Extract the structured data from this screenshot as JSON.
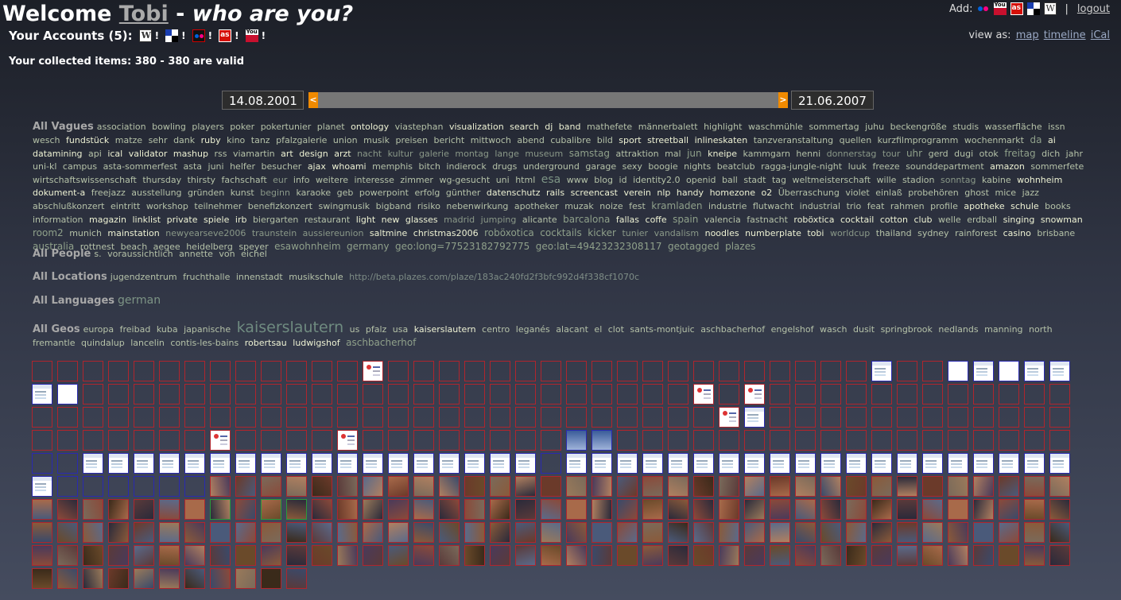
{
  "header": {
    "welcome": "Welcome ",
    "user": "Tobi",
    "dash": " - ",
    "question": "who are you?",
    "accounts_label": "Your Accounts (5):",
    "accounts": [
      {
        "service": "wordpress",
        "icon": "wordpress-icon"
      },
      {
        "service": "delicious",
        "icon": "delicious-icon"
      },
      {
        "service": "flickr",
        "icon": "flickr-icon"
      },
      {
        "service": "lastfm",
        "icon": "lastfm-icon"
      },
      {
        "service": "youtube",
        "icon": "youtube-icon"
      }
    ],
    "excl": "!",
    "collected": "Your collected items: 380 - 380 are valid"
  },
  "topright": {
    "add_label": "Add:",
    "separator": "|",
    "logout": "logout",
    "view_as": "view as:",
    "views": [
      "map",
      "timeline",
      "iCal"
    ]
  },
  "timeline": {
    "start": "14.08.2001",
    "end": "21.06.2007",
    "left_handle": "<",
    "right_handle": ">"
  },
  "tags": {
    "vagues_label": "All Vagues",
    "vagues": [
      [
        "association",
        ""
      ],
      [
        "bowling",
        ""
      ],
      [
        "players",
        ""
      ],
      [
        "poker",
        ""
      ],
      [
        "pokertunier",
        ""
      ],
      [
        "planet",
        ""
      ],
      [
        "ontology",
        "b"
      ],
      [
        "viastephan",
        ""
      ],
      [
        "visualization",
        "b"
      ],
      [
        "search",
        "b"
      ],
      [
        "dj",
        "b"
      ],
      [
        "band",
        "b"
      ],
      [
        "mathefete",
        ""
      ],
      [
        "männerbalett",
        ""
      ],
      [
        "highlight",
        ""
      ],
      [
        "waschmühle",
        ""
      ],
      [
        "sommertag",
        ""
      ],
      [
        "juhu",
        ""
      ],
      [
        "beckengröße",
        ""
      ],
      [
        "studis",
        ""
      ],
      [
        "wasserfläche",
        ""
      ],
      [
        "issn",
        ""
      ],
      [
        "wesch",
        ""
      ],
      [
        "fundstück",
        "b"
      ],
      [
        "matze",
        ""
      ],
      [
        "sehr",
        ""
      ],
      [
        "dank",
        ""
      ],
      [
        "ruby",
        "b"
      ],
      [
        "kino",
        ""
      ],
      [
        "tanz",
        ""
      ],
      [
        "pfalzgalerie",
        ""
      ],
      [
        "union",
        ""
      ],
      [
        "musik",
        ""
      ],
      [
        "preisen",
        ""
      ],
      [
        "bericht",
        ""
      ],
      [
        "mittwoch",
        ""
      ],
      [
        "abend",
        ""
      ],
      [
        "cubalibre",
        ""
      ],
      [
        "bild",
        ""
      ],
      [
        "sport",
        "b"
      ],
      [
        "streetball",
        "b"
      ],
      [
        "inlineskaten",
        "b"
      ],
      [
        "tanzveranstaltung",
        ""
      ],
      [
        "quellen",
        ""
      ],
      [
        "kurzfilmprogramm",
        ""
      ],
      [
        "wochenmarkt",
        ""
      ],
      [
        "da",
        "l1"
      ],
      [
        "ai",
        "b"
      ],
      [
        "datamining",
        "b"
      ],
      [
        "api",
        ""
      ],
      [
        "ical",
        "b"
      ],
      [
        "validator",
        "b"
      ],
      [
        "mashup",
        "b"
      ],
      [
        "rss",
        ""
      ],
      [
        "viamartin",
        ""
      ],
      [
        "art",
        "b"
      ],
      [
        "design",
        "b"
      ],
      [
        "arzt",
        "b"
      ],
      [
        "nacht",
        "d"
      ],
      [
        "kultur",
        "d"
      ],
      [
        "galerie",
        "d"
      ],
      [
        "montag",
        "d"
      ],
      [
        "lange",
        "d"
      ],
      [
        "museum",
        "d"
      ],
      [
        "samstag",
        "l1"
      ],
      [
        "attraktion",
        ""
      ],
      [
        "mal",
        ""
      ],
      [
        "jun",
        "l1"
      ],
      [
        "kneipe",
        "b"
      ],
      [
        "kammgarn",
        ""
      ],
      [
        "henni",
        ""
      ],
      [
        "donnerstag",
        "d"
      ],
      [
        "tour",
        "d"
      ],
      [
        "uhr",
        "l1"
      ],
      [
        "gerd",
        ""
      ],
      [
        "dugi",
        ""
      ],
      [
        "otok",
        ""
      ],
      [
        "freitag",
        "l1"
      ],
      [
        "dich",
        ""
      ],
      [
        "jahr",
        ""
      ],
      [
        "uni-kl",
        ""
      ],
      [
        "campus",
        ""
      ],
      [
        "asta-sommerfest",
        ""
      ],
      [
        "asta",
        ""
      ],
      [
        "juni",
        ""
      ],
      [
        "helfer",
        ""
      ],
      [
        "besucher",
        ""
      ],
      [
        "ajax",
        "b"
      ],
      [
        "whoami",
        "b"
      ],
      [
        "memphis",
        ""
      ],
      [
        "bitch",
        ""
      ],
      [
        "indierock",
        ""
      ],
      [
        "drugs",
        ""
      ],
      [
        "underground",
        ""
      ],
      [
        "garage",
        ""
      ],
      [
        "sexy",
        ""
      ],
      [
        "boogie",
        ""
      ],
      [
        "nights",
        ""
      ],
      [
        "beatclub",
        ""
      ],
      [
        "ragga-jungle-night",
        ""
      ],
      [
        "luuk",
        ""
      ],
      [
        "freeze",
        ""
      ],
      [
        "sounddepartment",
        ""
      ],
      [
        "amazon",
        "b"
      ],
      [
        "sommerfete",
        ""
      ],
      [
        "wirtschaftswissenschaft",
        ""
      ],
      [
        "thursday",
        ""
      ],
      [
        "thirsty",
        ""
      ],
      [
        "fachschaft",
        ""
      ],
      [
        "eur",
        "d"
      ],
      [
        "info",
        ""
      ],
      [
        "weitere",
        ""
      ],
      [
        "interesse",
        ""
      ],
      [
        "zimmer",
        ""
      ],
      [
        "wg-gesucht",
        ""
      ],
      [
        "uni",
        ""
      ],
      [
        "html",
        ""
      ],
      [
        "esa",
        "l2"
      ],
      [
        "www",
        ""
      ],
      [
        "blog",
        ""
      ],
      [
        "id",
        ""
      ],
      [
        "identity2.0",
        ""
      ],
      [
        "openid",
        ""
      ],
      [
        "ball",
        ""
      ],
      [
        "stadt",
        ""
      ],
      [
        "tag",
        ""
      ],
      [
        "weltmeisterschaft",
        ""
      ],
      [
        "wille",
        ""
      ],
      [
        "stadion",
        ""
      ],
      [
        "sonntag",
        "d"
      ],
      [
        "kabine",
        ""
      ],
      [
        "wohnheim",
        "b"
      ],
      [
        "dokument-a",
        "b"
      ],
      [
        "freejazz",
        ""
      ],
      [
        "ausstellung",
        ""
      ],
      [
        "gründen",
        ""
      ],
      [
        "kunst",
        ""
      ],
      [
        "beginn",
        "d"
      ],
      [
        "karaoke",
        ""
      ],
      [
        "geb",
        ""
      ],
      [
        "powerpoint",
        ""
      ],
      [
        "erfolg",
        ""
      ],
      [
        "günther",
        ""
      ],
      [
        "datenschutz",
        "b"
      ],
      [
        "rails",
        "b"
      ],
      [
        "screencast",
        "b"
      ],
      [
        "verein",
        "b"
      ],
      [
        "nlp",
        "b"
      ],
      [
        "handy",
        "b"
      ],
      [
        "homezone",
        "b"
      ],
      [
        "o2",
        "b"
      ],
      [
        "Überraschung",
        ""
      ],
      [
        "violet",
        ""
      ],
      [
        "einlaß",
        ""
      ],
      [
        "probehören",
        ""
      ],
      [
        "ghost",
        ""
      ],
      [
        "mice",
        ""
      ],
      [
        "jazz",
        ""
      ],
      [
        "abschlußkonzert",
        ""
      ],
      [
        "eintritt",
        ""
      ],
      [
        "workshop",
        ""
      ],
      [
        "teilnehmer",
        ""
      ],
      [
        "benefizkonzert",
        ""
      ],
      [
        "swingmusik",
        ""
      ],
      [
        "bigband",
        ""
      ],
      [
        "risiko",
        ""
      ],
      [
        "nebenwirkung",
        ""
      ],
      [
        "apotheker",
        ""
      ],
      [
        "muzak",
        ""
      ],
      [
        "noize",
        ""
      ],
      [
        "fest",
        ""
      ],
      [
        "kramladen",
        "l1"
      ],
      [
        "industrie",
        ""
      ],
      [
        "flutwacht",
        ""
      ],
      [
        "industrial",
        ""
      ],
      [
        "trio",
        ""
      ],
      [
        "feat",
        ""
      ],
      [
        "rahmen",
        ""
      ],
      [
        "profile",
        ""
      ],
      [
        "apotheke",
        "b"
      ],
      [
        "schule",
        "b"
      ],
      [
        "books",
        ""
      ],
      [
        "information",
        ""
      ],
      [
        "magazin",
        "b"
      ],
      [
        "linklist",
        "b"
      ],
      [
        "private",
        "b"
      ],
      [
        "spiele",
        "b"
      ],
      [
        "irb",
        "b"
      ],
      [
        "biergarten",
        ""
      ],
      [
        "restaurant",
        ""
      ],
      [
        "light",
        "b"
      ],
      [
        "new",
        "b"
      ],
      [
        "glasses",
        "b"
      ],
      [
        "madrid",
        "d"
      ],
      [
        "jumping",
        "d"
      ],
      [
        "alicante",
        ""
      ],
      [
        "barcalona",
        "l1"
      ],
      [
        "fallas",
        "b"
      ],
      [
        "coffe",
        "b"
      ],
      [
        "spain",
        "l1"
      ],
      [
        "valencia",
        ""
      ],
      [
        "fastnacht",
        ""
      ],
      [
        "roböxtica",
        "b"
      ],
      [
        "cocktail",
        "b"
      ],
      [
        "cotton",
        "b"
      ],
      [
        "club",
        "b"
      ],
      [
        "welle",
        ""
      ],
      [
        "erdball",
        ""
      ],
      [
        "singing",
        "b"
      ],
      [
        "snowman",
        "b"
      ],
      [
        "room2",
        "l1"
      ],
      [
        "munich",
        ""
      ],
      [
        "mainstation",
        "b"
      ],
      [
        "newyearseve2006",
        "d"
      ],
      [
        "traunstein",
        "d"
      ],
      [
        "aussiereunion",
        "d"
      ],
      [
        "saltmine",
        "b"
      ],
      [
        "christmas2006",
        "b"
      ],
      [
        "roböxotica",
        "l1"
      ],
      [
        "cocktails",
        "l1"
      ],
      [
        "kicker",
        "l1"
      ],
      [
        "tunier",
        "d"
      ],
      [
        "vandalism",
        "d"
      ],
      [
        "noodles",
        "b"
      ],
      [
        "numberplate",
        "b"
      ],
      [
        "tobi",
        "b"
      ],
      [
        "worldcup",
        "d"
      ],
      [
        "thailand",
        ""
      ],
      [
        "sydney",
        ""
      ],
      [
        "rainforest",
        ""
      ],
      [
        "casino",
        "b"
      ],
      [
        "brisbane",
        ""
      ],
      [
        "australia",
        "l1"
      ],
      [
        "rottnest",
        ""
      ],
      [
        "beach",
        ""
      ],
      [
        "aegee",
        ""
      ],
      [
        "heidelberg",
        ""
      ],
      [
        "speyer",
        ""
      ],
      [
        "esawohnheim",
        "l1"
      ],
      [
        "germany",
        "l1"
      ],
      [
        "geo:long=77523182792775",
        "l1"
      ],
      [
        "geo:lat=49423232308117",
        "l1"
      ],
      [
        "geotagged",
        "l1"
      ],
      [
        "plazes",
        "l1"
      ]
    ],
    "people_label": "All People",
    "people": [
      [
        "s.",
        ""
      ],
      [
        "voraussichtlich",
        ""
      ],
      [
        "annette",
        ""
      ],
      [
        "von",
        ""
      ],
      [
        "eichel",
        ""
      ]
    ],
    "locations_label": "All Locations",
    "locations": [
      [
        "jugendzentrum",
        ""
      ],
      [
        "fruchthalle",
        ""
      ],
      [
        "innenstadt",
        ""
      ],
      [
        "musikschule",
        ""
      ],
      [
        "http://beta.plazes.com/plaze/183ac240fd2f3bfc992d4f338cf1070c",
        "u"
      ]
    ],
    "languages_label": "All Languages",
    "languages": [
      [
        "german",
        "l2"
      ]
    ],
    "geos_label": "All Geos",
    "geos": [
      [
        "europa",
        ""
      ],
      [
        "freibad",
        ""
      ],
      [
        "kuba",
        ""
      ],
      [
        "japanische",
        ""
      ],
      [
        "kaiserslautern",
        "l3"
      ],
      [
        "us",
        ""
      ],
      [
        "pfalz",
        ""
      ],
      [
        "usa",
        ""
      ],
      [
        "kaiserslautern",
        "b"
      ],
      [
        "centro",
        ""
      ],
      [
        "leganés",
        ""
      ],
      [
        "alacant",
        ""
      ],
      [
        "el",
        ""
      ],
      [
        "clot",
        ""
      ],
      [
        "sants-montjuic",
        ""
      ],
      [
        "aschbacherhof",
        ""
      ],
      [
        "engelshof",
        ""
      ],
      [
        "wasch",
        ""
      ],
      [
        "dusit",
        ""
      ],
      [
        "springbrook",
        ""
      ],
      [
        "nedlands",
        ""
      ],
      [
        "manning",
        ""
      ],
      [
        "north",
        ""
      ],
      [
        "fremantle",
        ""
      ],
      [
        "quindalup",
        ""
      ],
      [
        "lancelin",
        ""
      ],
      [
        "contis-les-bains",
        ""
      ],
      [
        "robertsau",
        "b"
      ],
      [
        "ludwigshof",
        "b"
      ],
      [
        "aschbacherhof",
        "l1"
      ]
    ]
  },
  "colors": {
    "accent": "#f08a00",
    "item_border": "#b0252d",
    "web_border": "#2a2ab0",
    "video_border": "#2a9a3a"
  }
}
